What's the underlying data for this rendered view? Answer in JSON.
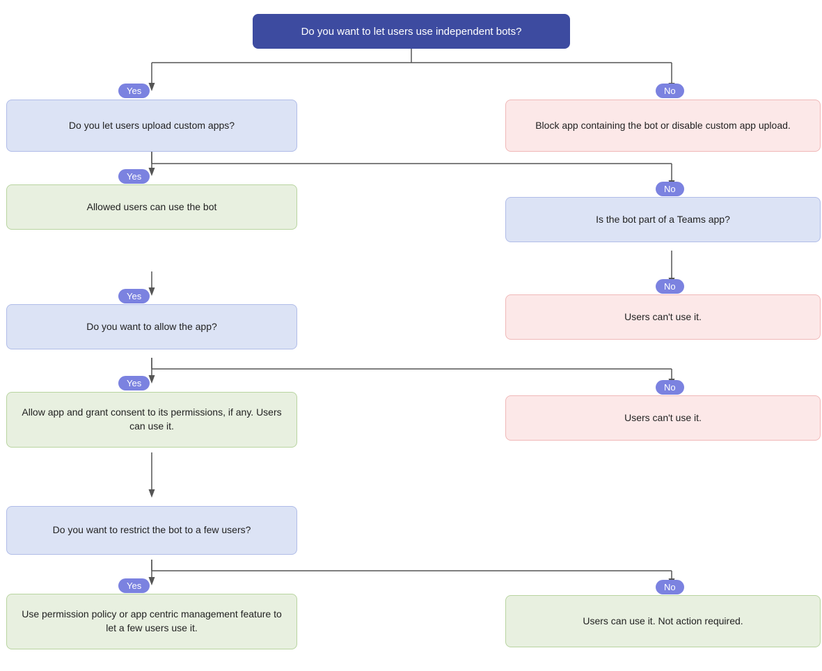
{
  "nodes": {
    "root": {
      "label": "Do you want to let users use independent bots?"
    },
    "n1": {
      "label": "Do you let users upload\ncustom apps?"
    },
    "n2": {
      "label": "Block app containing the bot or disable\ncustom app upload."
    },
    "n3": {
      "label": "Allowed users can use the bot"
    },
    "n4": {
      "label": "Is the bot part of a Teams app?"
    },
    "n5": {
      "label": "Do you want to allow the app?"
    },
    "n6": {
      "label": "Users can't use it."
    },
    "n7": {
      "label": "Allow app and grant consent to its permissions,\nif any. Users can use it."
    },
    "n8": {
      "label": "Users can't use it."
    },
    "n9": {
      "label": "Do you want to restrict the bot to a few users?"
    },
    "n10": {
      "label": "Use permission policy or app centric management\nfeature to let a few users use it."
    },
    "n11": {
      "label": "Users can use it. Not action required."
    }
  },
  "badges": {
    "yes1": "Yes",
    "no1": "No",
    "yes2": "Yes",
    "no2": "No",
    "yes3": "Yes",
    "no3": "No",
    "yes4": "Yes",
    "no4": "No",
    "yes5": "Yes",
    "no5": "No"
  }
}
